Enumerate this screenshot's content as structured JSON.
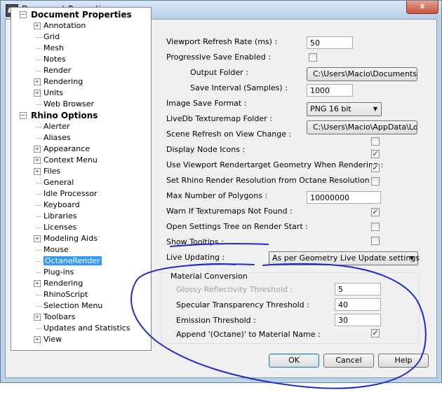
{
  "window": {
    "title": "Document Properties",
    "close_label": "x"
  },
  "tree": {
    "document_properties": {
      "label": "Document Properties",
      "children": [
        "Annotation",
        "Grid",
        "Mesh",
        "Notes",
        "Render",
        "Rendering",
        "Units",
        "Web Browser"
      ]
    },
    "rhino_options": {
      "label": "Rhino Options",
      "children": [
        "Alerter",
        "Aliases",
        "Appearance",
        "Context Menu",
        "Files",
        "General",
        "Idle Processor",
        "Keyboard",
        "Libraries",
        "Licenses",
        "Modeling Aids",
        "Mouse",
        "OctaneRender",
        "Plug-ins",
        "Rendering",
        "RhinoScript",
        "Selection Menu",
        "Toolbars",
        "Updates and Statistics",
        "View"
      ]
    },
    "selected": "OctaneRender",
    "expander": "+",
    "collapse": "−"
  },
  "settings": {
    "viewport_refresh_rate": {
      "label": "Viewport Refresh Rate (ms) :",
      "value": "50"
    },
    "progressive_save_enabled": {
      "label": "Progressive Save Enabled :",
      "checked": false
    },
    "output_folder": {
      "label": "Output Folder :",
      "value": "C:\\Users\\Macio\\Documents"
    },
    "save_interval": {
      "label": "Save Interval (Samples) :",
      "value": "1000"
    },
    "image_save_format": {
      "label": "Image Save Format :",
      "value": "PNG 16 bit"
    },
    "livedb_texturemap_folder": {
      "label": "LiveDb Texturemap Folder :",
      "value": "C:\\Users\\Macio\\AppData\\Lo"
    },
    "scene_refresh_on_view_change": {
      "label": "Scene Refresh on View Change :",
      "checked": false
    },
    "display_node_icons": {
      "label": "Display Node Icons :",
      "checked": true
    },
    "use_viewport_rendertarget": {
      "label": "Use Viewport Rendertarget Geometry When Rendering :",
      "checked": true
    },
    "set_rhino_render_resolution": {
      "label": "Set Rhino Render Resolution from Octane Resolution :",
      "checked": false
    },
    "max_number_of_polygons": {
      "label": "Max Number of Polygons :",
      "value": "10000000"
    },
    "warn_if_texturemaps_not_found": {
      "label": "Warn If Texturemaps Not Found :",
      "checked": true
    },
    "open_settings_tree": {
      "label": "Open Settings Tree on Render Start :",
      "checked": false
    },
    "show_tooltips": {
      "label": "Show Tooltips :",
      "checked": false
    },
    "live_updating": {
      "label": "Live Updating :",
      "value": "As per Geometry Live Update settings"
    }
  },
  "material_conversion": {
    "group_label": "Material Conversion",
    "glossy_reflectivity_threshold": {
      "label": "Glossy Reflectivity Threshold :",
      "value": "5"
    },
    "specular_transparency_threshold": {
      "label": "Specular Transparency Threshold :",
      "value": "40"
    },
    "emission_threshold": {
      "label": "Emission Threshold :",
      "value": "30"
    },
    "append_octane": {
      "label": "Append '(Octane)' to Material Name :",
      "checked": true
    }
  },
  "buttons": {
    "ok": "OK",
    "cancel": "Cancel",
    "help": "Help"
  },
  "icons": {
    "checkmark": "✓",
    "dropdown_arrow": "▼"
  },
  "colors": {
    "annotation_ink": "#1f2ad0",
    "selection": "#3399ff"
  }
}
